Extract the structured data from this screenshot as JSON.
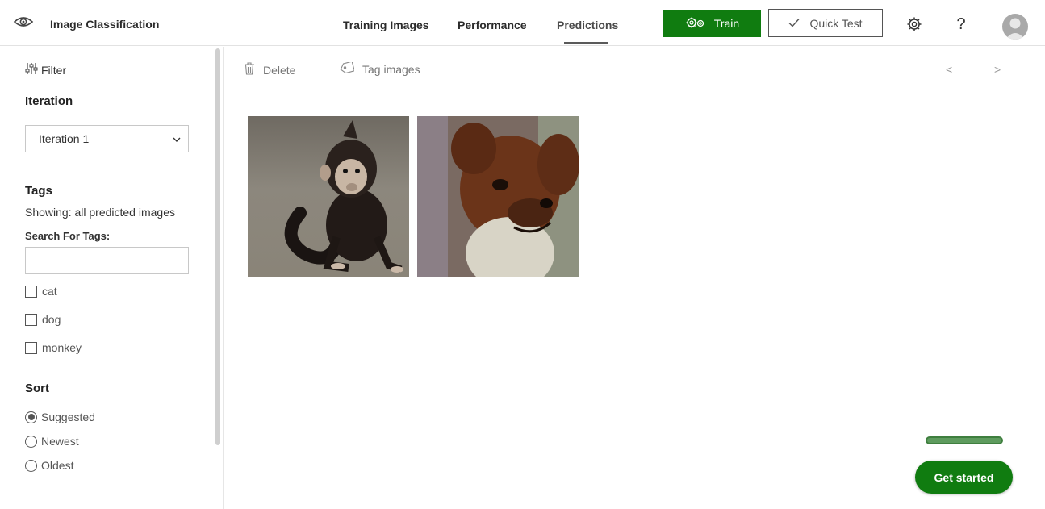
{
  "header": {
    "app_title": "Image Classification",
    "tabs": [
      {
        "label": "Training Images",
        "active": false
      },
      {
        "label": "Performance",
        "active": false
      },
      {
        "label": "Predictions",
        "active": true
      }
    ],
    "train_label": "Train",
    "quick_test_label": "Quick Test",
    "help_label": "?"
  },
  "sidebar": {
    "filter_label": "Filter",
    "iteration_heading": "Iteration",
    "iteration_selected": "Iteration 1",
    "tags_heading": "Tags",
    "showing_text": "Showing: all predicted images",
    "search_label": "Search For Tags:",
    "search_value": "",
    "tags": [
      {
        "label": "cat",
        "checked": false
      },
      {
        "label": "dog",
        "checked": false
      },
      {
        "label": "monkey",
        "checked": false
      }
    ],
    "sort_heading": "Sort",
    "sort_options": [
      {
        "label": "Suggested",
        "selected": true
      },
      {
        "label": "Newest",
        "selected": false
      },
      {
        "label": "Oldest",
        "selected": false
      }
    ]
  },
  "toolbar": {
    "delete_label": "Delete",
    "tag_label": "Tag images",
    "prev_label": "<",
    "next_label": ">"
  },
  "images": [
    {
      "subject": "monkey"
    },
    {
      "subject": "dog"
    }
  ],
  "get_started_label": "Get started",
  "colors": {
    "accent": "#107c10",
    "text": "#222222",
    "muted": "#777777"
  }
}
